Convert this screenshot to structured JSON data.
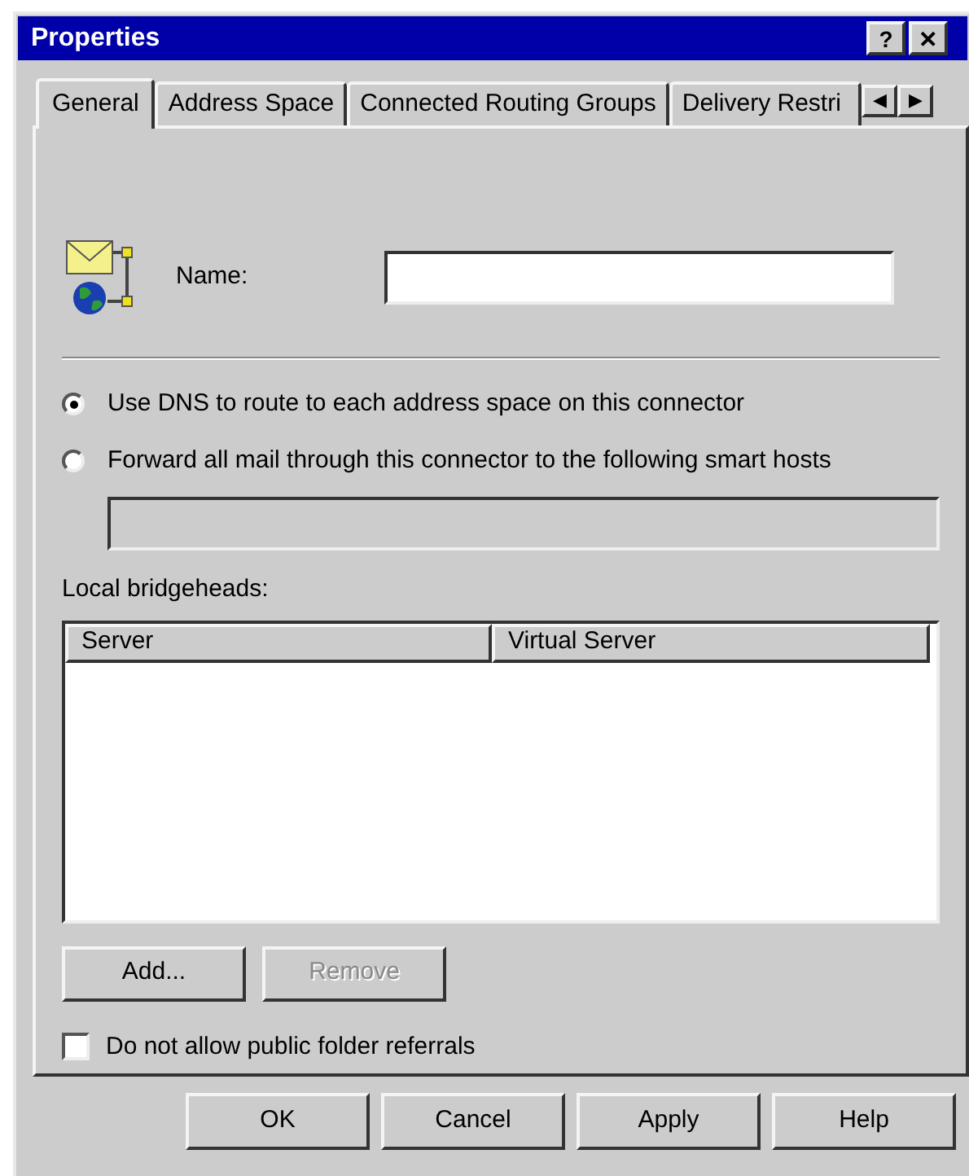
{
  "window": {
    "title": "Properties",
    "title_buttons": [
      "?",
      "✕"
    ]
  },
  "tabs": [
    {
      "label": "General",
      "selected": true
    },
    {
      "label": "Address Space",
      "selected": false
    },
    {
      "label": "Connected Routing Groups",
      "selected": false
    },
    {
      "label": "Delivery Restri",
      "selected": false
    }
  ],
  "tab_scroll": [
    "◀",
    "▶"
  ],
  "name_field": {
    "label": "Name:"
  },
  "routing_options": [
    {
      "label": "Use DNS to route to each address space on this connector",
      "selected": true
    },
    {
      "label": "Forward all mail through this connector to the following smart hosts",
      "selected": false
    }
  ],
  "smart_hosts_field": {
    "disabled": true
  },
  "bridgeheads": {
    "label": "Local bridgeheads:",
    "columns": [
      "Server",
      "Virtual Server"
    ],
    "buttons": [
      {
        "label": "Add...",
        "disabled": false
      },
      {
        "label": "Remove",
        "disabled": true
      }
    ]
  },
  "public_folder_referrals": {
    "label": "Do not allow public folder referrals",
    "checked": false
  },
  "buttons": [
    "OK",
    "Cancel",
    "Apply",
    "Help"
  ]
}
